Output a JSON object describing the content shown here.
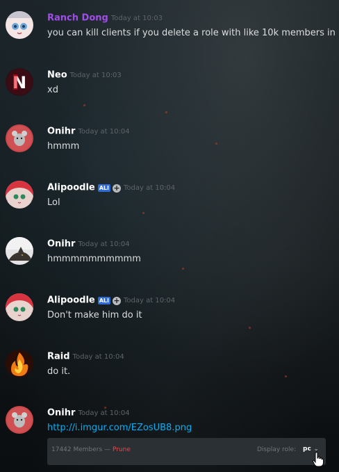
{
  "messages": [
    {
      "user": "Ranch Dong",
      "user_color": "#a14ee8",
      "time": "Today at 10:03",
      "text": "you can kill clients if you delete a role with like 10k members in it",
      "avatar": "anime-girl-avatar"
    },
    {
      "user": "Neo",
      "user_color": "#ffffff",
      "time": "Today at 10:03",
      "text": "xd",
      "avatar": "netflix-n-avatar"
    },
    {
      "user": "Onihr",
      "user_color": "#ffffff",
      "time": "Today at 10:04",
      "text": "hmmm",
      "avatar": "mouse-avatar"
    },
    {
      "user": "Alipoodle",
      "user_color": "#ffffff",
      "time": "Today at 10:04",
      "text": "Lol",
      "avatar": "red-hair-anime-avatar",
      "tag": "ALI"
    },
    {
      "user": "Onihr",
      "user_color": "#ffffff",
      "time": "Today at 10:04",
      "text": "hmmmmmmmmmm",
      "avatar": "cat-photo-avatar"
    },
    {
      "user": "Alipoodle",
      "user_color": "#ffffff",
      "time": "Today at 10:04",
      "text": "Don't make him do it",
      "avatar": "red-hair-anime-avatar",
      "tag": "ALI"
    },
    {
      "user": "Raid",
      "user_color": "#ffffff",
      "time": "Today at 10:04",
      "text": "do it.",
      "avatar": "flame-avatar"
    },
    {
      "user": "Onihr",
      "user_color": "#ffffff",
      "time": "Today at 10:04",
      "text": "http://i.imgur.com/EZosUB8.png",
      "avatar": "mouse-avatar"
    }
  ],
  "embed": {
    "members": "17442 Members",
    "separator": "—",
    "prune": "Prune",
    "display_role_label": "Display role:",
    "display_role_value": "pc"
  },
  "colors": {
    "link": "#00b0f4",
    "prune": "#f04747",
    "tag_bg": "#2f6bd8"
  }
}
